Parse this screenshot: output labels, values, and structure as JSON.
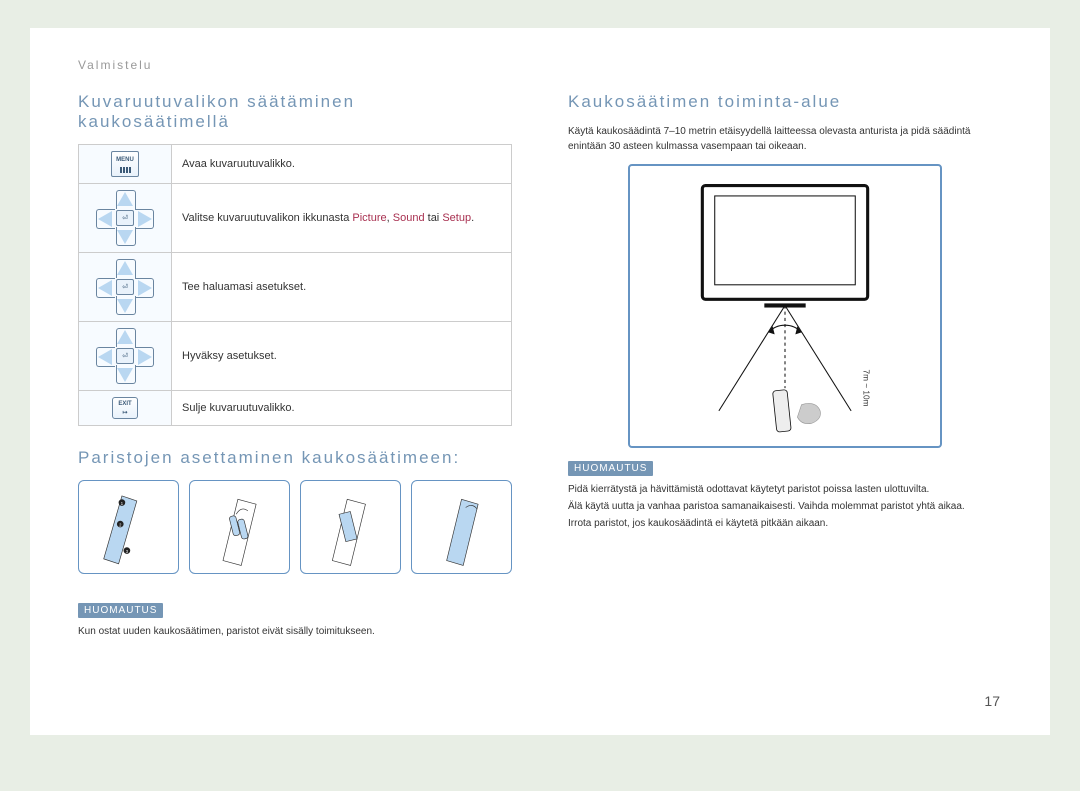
{
  "tab": "Valmistelu",
  "left": {
    "heading1": "Kuvaruutuvalikon säätäminen kaukosäätimellä",
    "rows": {
      "r1": "Avaa kuvaruutuvalikko.",
      "r2_pre": "Valitse kuvaruutuvalikon ikkunasta ",
      "r2_w1": "Picture",
      "r2_mid1": ", ",
      "r2_w2": "Sound",
      "r2_mid2": " tai ",
      "r2_w3": "Setup",
      "r2_end": ".",
      "r3": "Tee haluamasi asetukset.",
      "r4": "Hyväksy asetukset.",
      "r5": "Sulje kuvaruutuvalikko."
    },
    "icons": {
      "menu": "MENU",
      "exit": "EXIT",
      "enter": "⏎"
    },
    "heading2": "Paristojen asettaminen kaukosäätimeen:",
    "note_label": "HUOMAUTUS",
    "note_text": "Kun ostat uuden kaukosäätimen, paristot eivät sisälly toimitukseen."
  },
  "right": {
    "heading": "Kaukosäätimen toiminta-alue",
    "intro": "Käytä kaukosäädintä 7–10 metrin etäisyydellä laitteessa olevasta anturista ja pidä säädintä enintään 30 asteen kulmassa vasempaan tai oikeaan.",
    "diagram_label": "7m ~ 10m",
    "note_label": "HUOMAUTUS",
    "note_lines": {
      "l1": "Pidä kierrätystä ja hävittämistä odottavat käytetyt paristot poissa lasten ulottuvilta.",
      "l2": "Älä käytä uutta ja vanhaa paristoa samanaikaisesti. Vaihda molemmat paristot yhtä aikaa.",
      "l3": "Irrota paristot, jos kaukosäädintä ei käytetä pitkään aikaan."
    }
  },
  "page_number": "17"
}
